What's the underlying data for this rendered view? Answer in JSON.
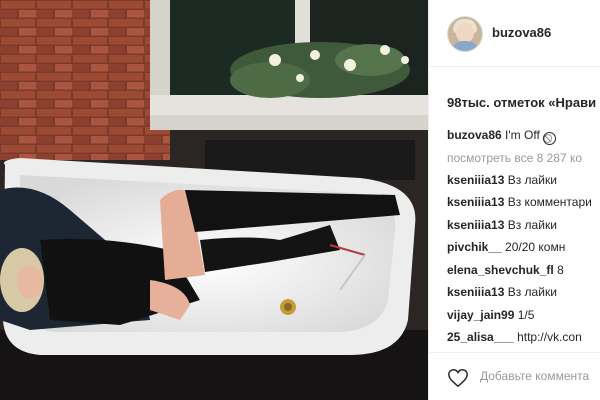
{
  "post": {
    "username": "buzova86",
    "likes_text": "98тыс. отметок «Нрави",
    "caption": {
      "user": "buzova86",
      "text": "I'm Off",
      "icon": "no-entry-icon"
    },
    "view_all": "посмотреть все 8 287 ко",
    "comments": [
      {
        "user": "kseniiia13",
        "text": "Вз лайки"
      },
      {
        "user": "kseniiia13",
        "text": "Вз комментари"
      },
      {
        "user": "kseniiia13",
        "text": "Вз лайки"
      },
      {
        "user": "pivchik__",
        "text": "20/20 комн"
      },
      {
        "user": "elena_shevchuk_fl",
        "text": "8"
      },
      {
        "user": "kseniiia13",
        "text": "Вз лайки"
      },
      {
        "user": "vijay_jain99",
        "text": "1/5"
      },
      {
        "user": "25_alisa___",
        "text": "http://vk.con"
      }
    ],
    "add_comment_placeholder": "Добавьте коммента",
    "icons": {
      "like": "heart-icon"
    },
    "colors": {
      "text": "#262626",
      "muted": "#999999",
      "divider": "#efefef"
    }
  }
}
